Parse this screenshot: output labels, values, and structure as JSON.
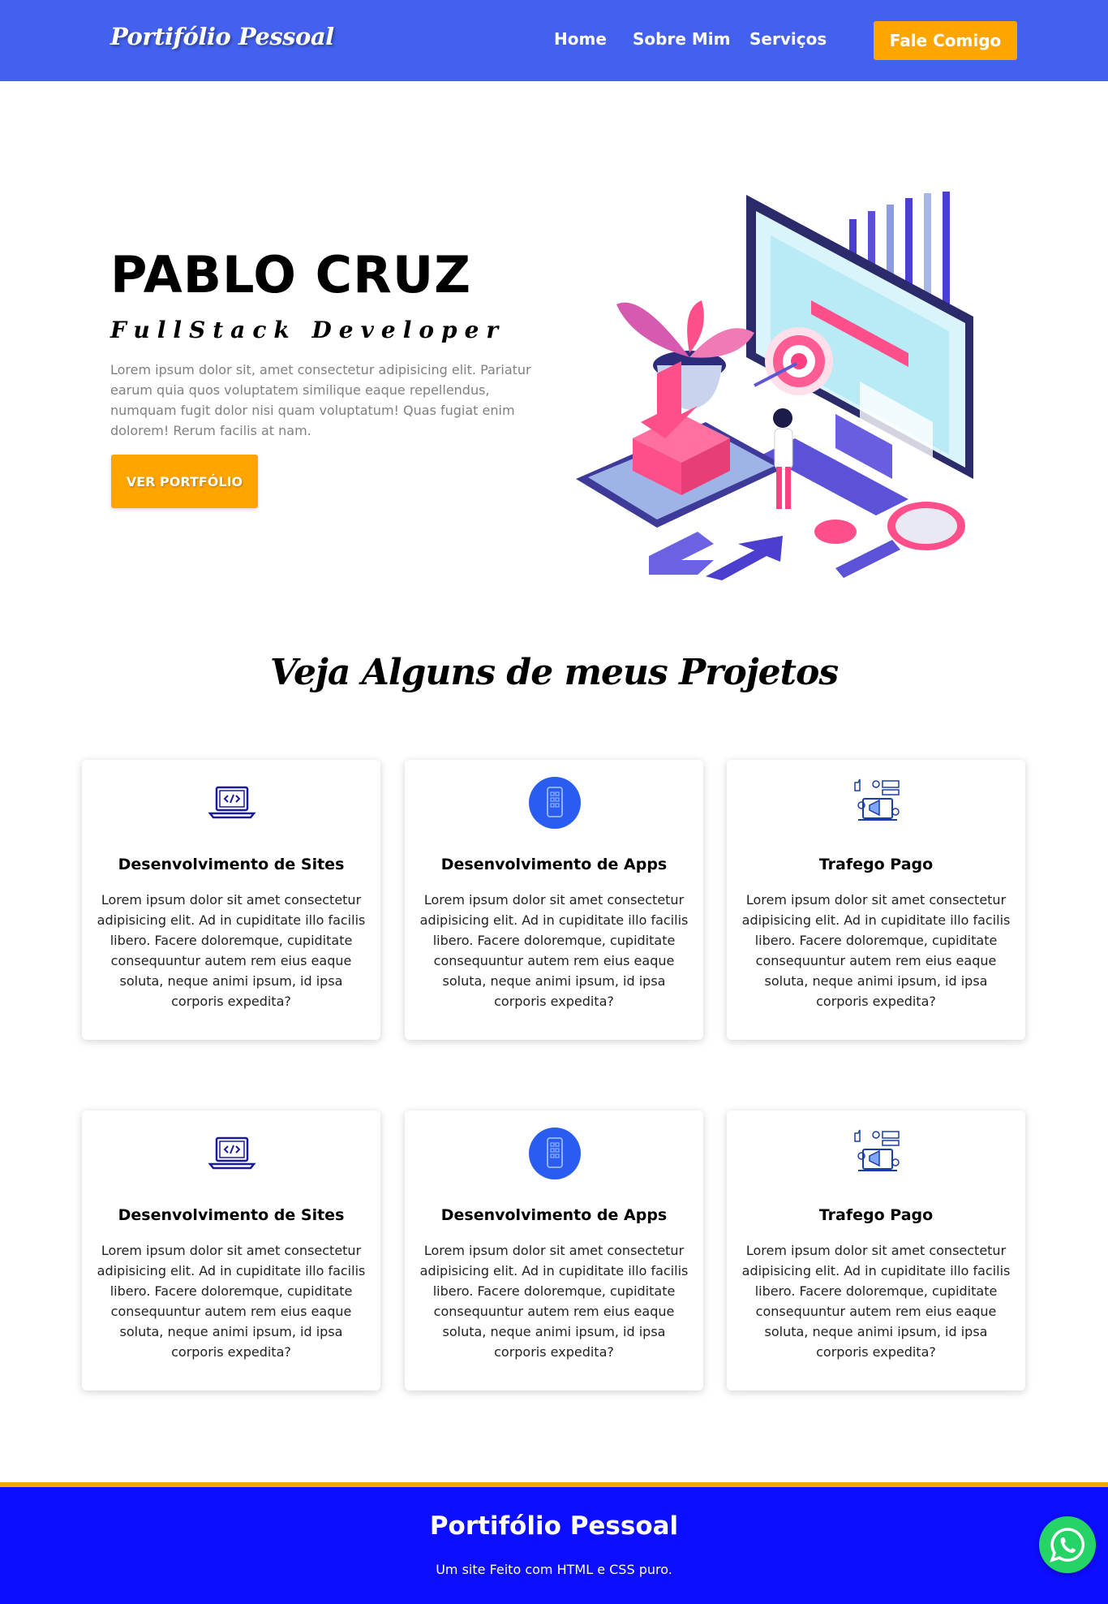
{
  "header": {
    "logo": "Portifólio Pessoal",
    "nav": [
      "Home",
      "Sobre Mim",
      "Serviços"
    ],
    "cta": "Fale Comigo"
  },
  "hero": {
    "name": "PABLO CRUZ",
    "role": "FullStack Developer",
    "text": "Lorem ipsum dolor sit, amet consectetur adipisicing elit. Pariatur earum quia quos voluptatem similique eaque repellendus, numquam fugit dolor nisi quam voluptatum! Quas fugiat enim dolorem! Rerum facilis at nam.",
    "button": "VER PORTFÓLIO"
  },
  "projects": {
    "title": "Veja Alguns de meus Projetos",
    "cards": [
      {
        "icon": "laptop-code-icon",
        "title": "Desenvolvimento de Sites",
        "text": "Lorem ipsum dolor sit amet consectetur adipisicing elit. Ad in cupiditate illo facilis libero. Facere doloremque, cupiditate consequuntur autem rem eius eaque soluta, neque animi ipsum, id ipsa corporis expedita?"
      },
      {
        "icon": "mobile-app-icon",
        "title": "Desenvolvimento de Apps",
        "text": "Lorem ipsum dolor sit amet consectetur adipisicing elit. Ad in cupiditate illo facilis libero. Facere doloremque, cupiditate consequuntur autem rem eius eaque soluta, neque animi ipsum, id ipsa corporis expedita?"
      },
      {
        "icon": "paid-traffic-icon",
        "title": "Trafego Pago",
        "text": "Lorem ipsum dolor sit amet consectetur adipisicing elit. Ad in cupiditate illo facilis libero. Facere doloremque, cupiditate consequuntur autem rem eius eaque soluta, neque animi ipsum, id ipsa corporis expedita?"
      },
      {
        "icon": "laptop-code-icon",
        "title": "Desenvolvimento de Sites",
        "text": "Lorem ipsum dolor sit amet consectetur adipisicing elit. Ad in cupiditate illo facilis libero. Facere doloremque, cupiditate consequuntur autem rem eius eaque soluta, neque animi ipsum, id ipsa corporis expedita?"
      },
      {
        "icon": "mobile-app-icon",
        "title": "Desenvolvimento de Apps",
        "text": "Lorem ipsum dolor sit amet consectetur adipisicing elit. Ad in cupiditate illo facilis libero. Facere doloremque, cupiditate consequuntur autem rem eius eaque soluta, neque animi ipsum, id ipsa corporis expedita?"
      },
      {
        "icon": "paid-traffic-icon",
        "title": "Trafego Pago",
        "text": "Lorem ipsum dolor sit amet consectetur adipisicing elit. Ad in cupiditate illo facilis libero. Facere doloremque, cupiditate consequuntur autem rem eius eaque soluta, neque animi ipsum, id ipsa corporis expedita?"
      }
    ]
  },
  "footer": {
    "title": "Portifólio Pessoal",
    "text": "Um site Feito com HTML e CSS puro."
  },
  "colors": {
    "header": "#4361ee",
    "accent": "#ffa500",
    "footer": "#0d0dff",
    "whatsapp": "#25d366"
  },
  "floating": {
    "icon": "whatsapp-icon"
  }
}
